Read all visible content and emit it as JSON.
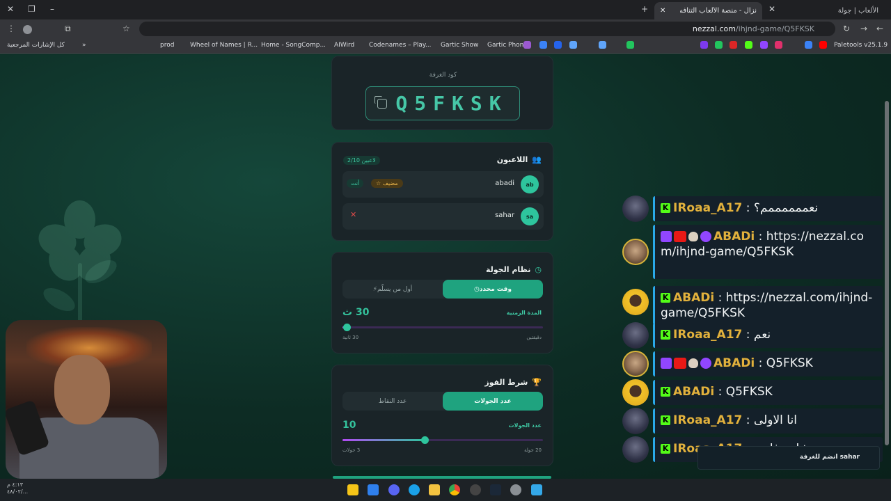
{
  "browser": {
    "tabs": [
      {
        "title": "الألعاب | جولة",
        "active": false
      },
      {
        "title": "نزال - منصة الألعاب التنافسية الع",
        "active": true
      }
    ],
    "url_domain": "nezzal.com",
    "url_path": "/ihjnd-game/Q5FKSK",
    "bookmarks": [
      "Paletools v25.1.9",
      "Gartic Phone",
      "Gartic Show",
      "Codenames – Play...",
      "AIWird",
      "Home - SongComp...",
      "Wheel of Names | R...",
      "prod",
      "كل الإشارات المرجعية"
    ]
  },
  "room": {
    "label": "كود الغرفة",
    "code": "Q5FKSK"
  },
  "players": {
    "title": "اللاعبون",
    "count_badge": "2/10 لاعبين",
    "list": [
      {
        "initials": "ab",
        "name": "abadi",
        "host_label": "مضيف",
        "you_label": "أنت"
      },
      {
        "initials": "sa",
        "name": "sahar",
        "kick": "✕"
      }
    ]
  },
  "round_system": {
    "title": "نظام الجولة",
    "option_on": "وقت محدد",
    "option_off": "أول من يسلّم",
    "duration_label": "المدة الزمنية",
    "duration_value": "30 ث",
    "duration_fraction": 0.02,
    "min_label": "30 ثانية",
    "max_label": "دقيقتين"
  },
  "win_condition": {
    "title": "شرط الفوز",
    "option_on": "عدد الجولات",
    "option_off": "عدد النقاط",
    "rounds_label": "عدد الجولات",
    "rounds_value": "10",
    "rounds_fraction": 0.41,
    "min_label": "3 جولات",
    "max_label": "20 جولة"
  },
  "chat": [
    {
      "user": "IRoaa_A17",
      "text": "نعممممممم؟",
      "platform": "kick",
      "avatar": "dark"
    },
    {
      "user": "ABADi",
      "text": "https://nezzal.com/ihjnd-game/Q5FKSK",
      "platform": "twitch",
      "avatar": "face"
    },
    {
      "user": "ABADi",
      "text": "https://nezzal.com/ihjnd-game/Q5FKSK",
      "platform": "kick",
      "avatar": "yellow"
    },
    {
      "user": "IRoaa_A17",
      "text": "نعم",
      "platform": "kick",
      "avatar": "dark"
    },
    {
      "user": "ABADi",
      "text": "Q5FKSK",
      "platform": "twitch",
      "avatar": "face"
    },
    {
      "user": "ABADi",
      "text": "Q5FKSK",
      "platform": "kick",
      "avatar": "yellow"
    },
    {
      "user": "IRoaa_A17",
      "text": "انا الاولى",
      "platform": "kick",
      "avatar": "dark"
    },
    {
      "user": "IRoaa_A17",
      "text": "عشاني فايزة",
      "platform": "kick",
      "avatar": "dark"
    }
  ],
  "join_notice": "sahar انضم للغرفة",
  "clock": {
    "time": "٤:١٣ م",
    "date": "٤٨/٠٢/..."
  }
}
